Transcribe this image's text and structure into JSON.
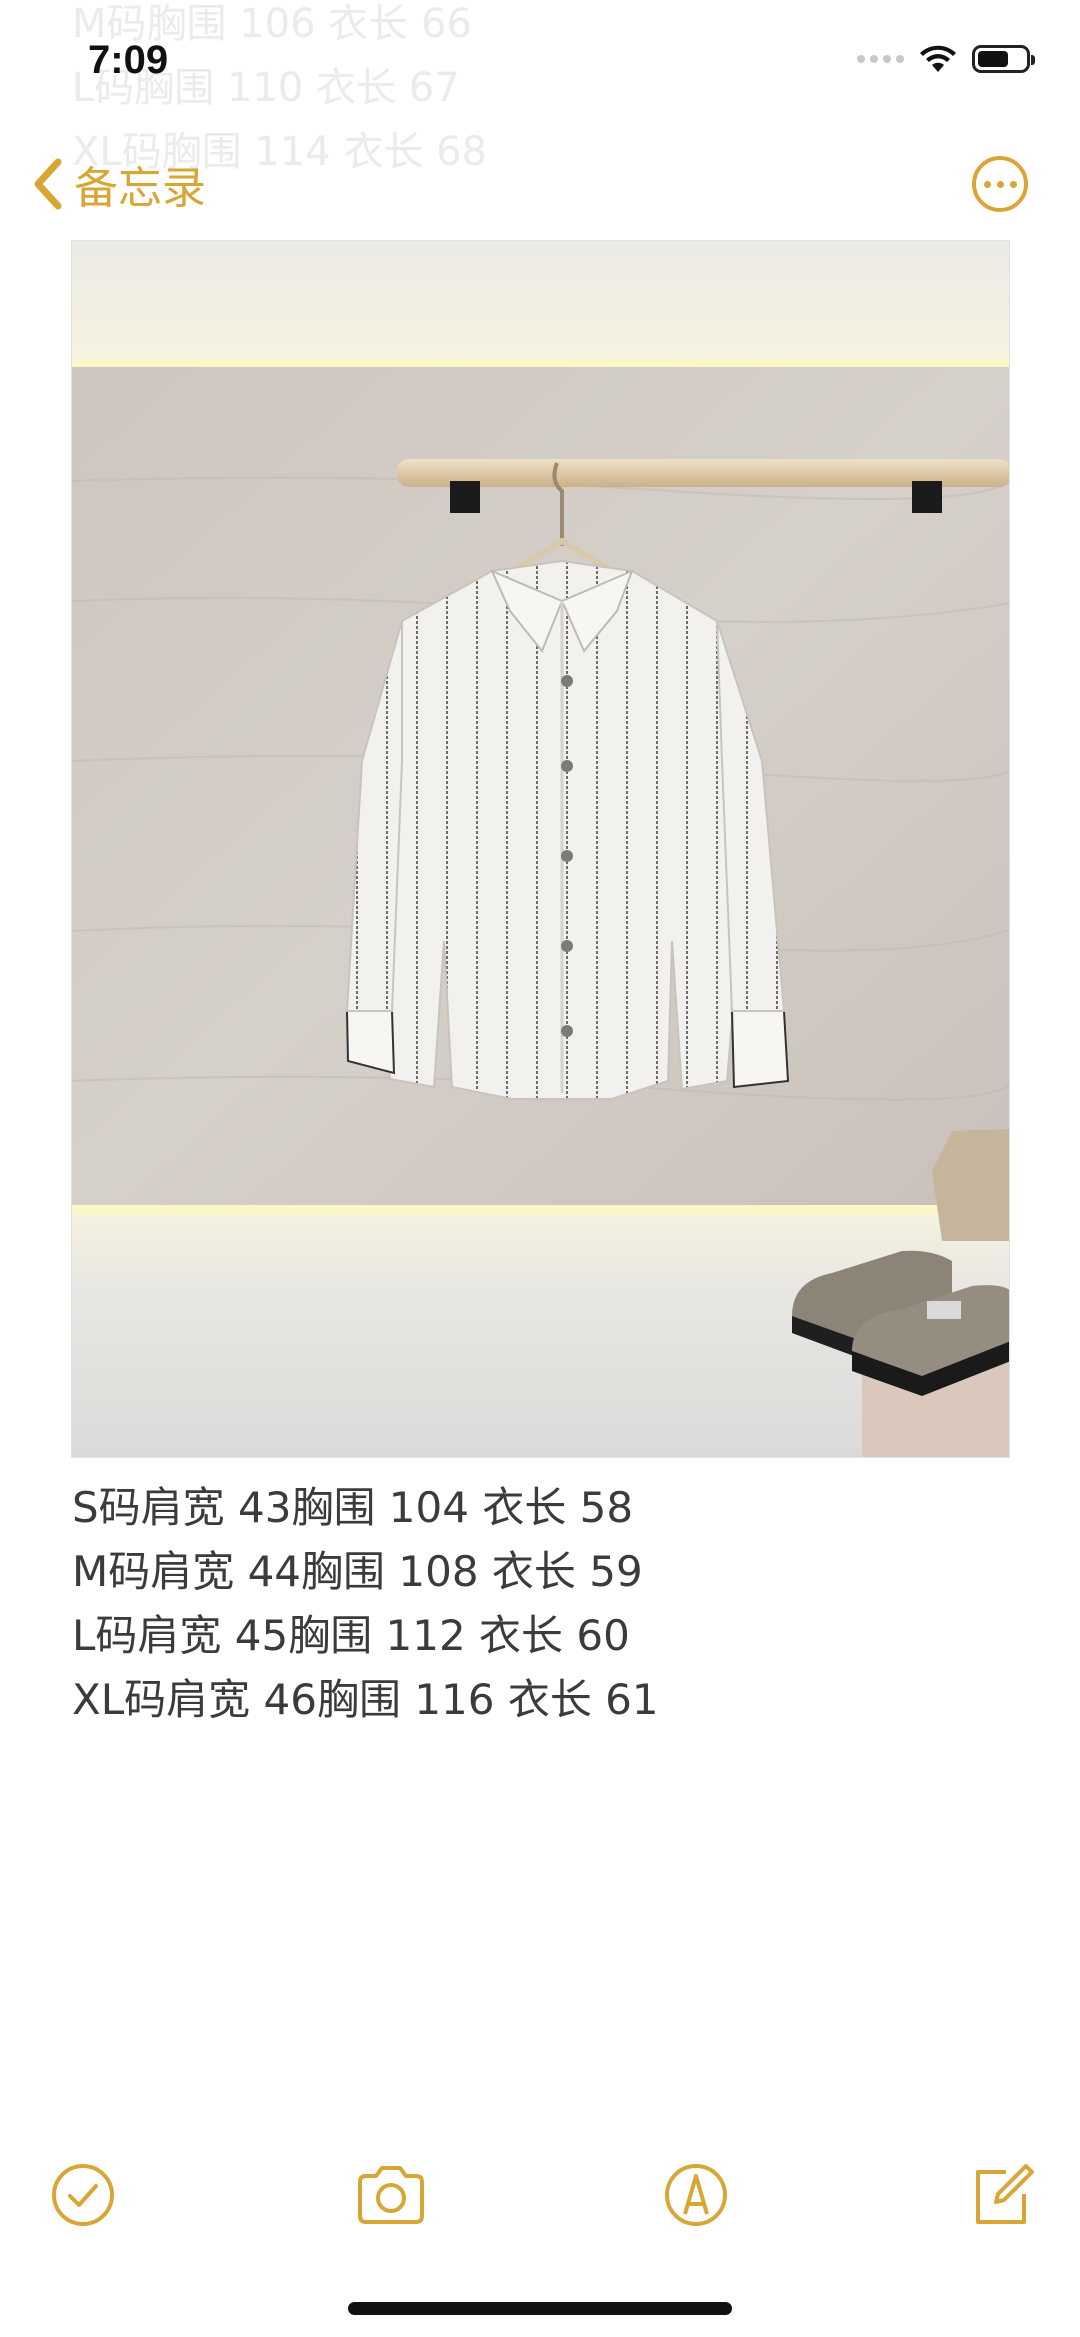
{
  "ghost_lines": [
    "M码胸围 106 衣长 66",
    "L码胸围 110 衣长 67",
    "XL码胸围 114 衣长 68"
  ],
  "status_bar": {
    "time": "7:09"
  },
  "nav": {
    "back_label": "备忘录"
  },
  "note_lines": [
    "S码肩宽 43胸围 104 衣长 58",
    "M码肩宽 44胸围 108 衣长 59",
    "L码肩宽 45胸围 112 衣长 60",
    "XL码肩宽 46胸围 116 衣长 61"
  ],
  "colors": {
    "accent": "#d7a635",
    "text": "#3b3b3b"
  },
  "toolbar": {
    "icons": [
      "checklist-icon",
      "camera-icon",
      "markup-icon",
      "compose-icon"
    ]
  }
}
